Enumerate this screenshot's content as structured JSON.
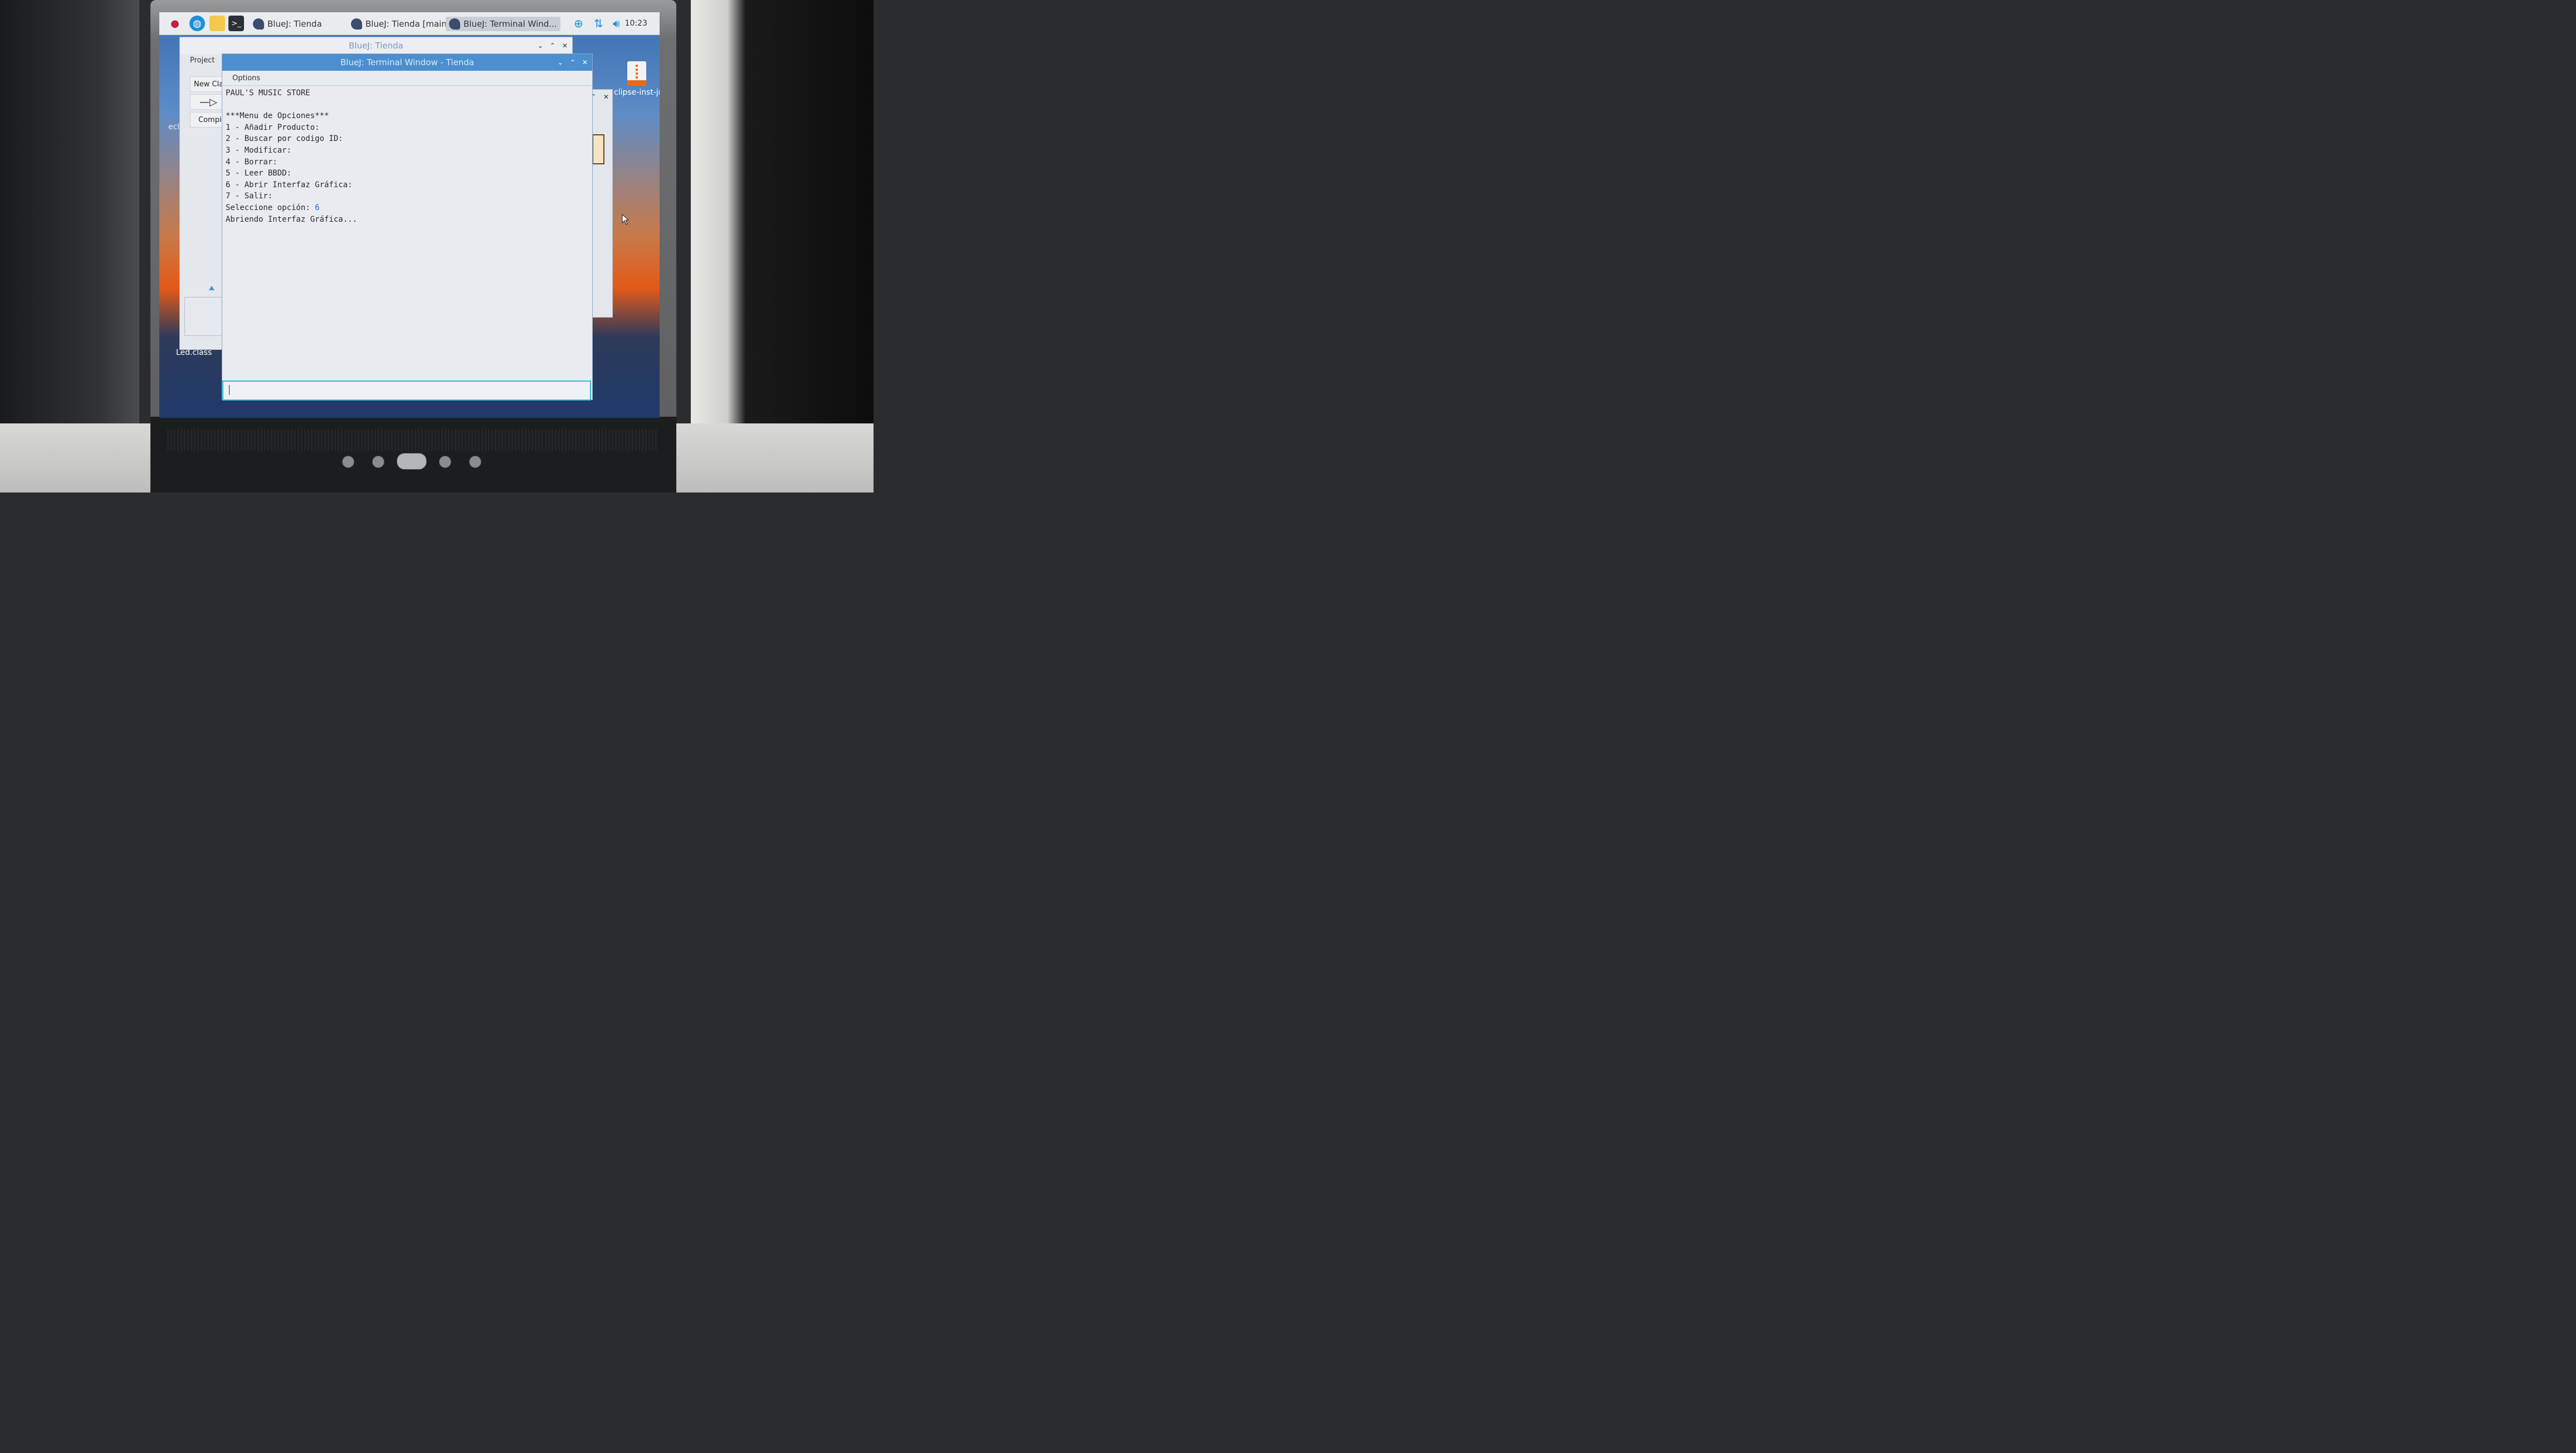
{
  "taskbar": {
    "tasks": [
      {
        "label": "BlueJ: Tienda"
      },
      {
        "label": "BlueJ: Tienda  [main]"
      },
      {
        "label": "BlueJ: Terminal Wind..."
      }
    ],
    "clock": "10:23",
    "icons": [
      "raspberry-menu-icon",
      "web-browser-icon",
      "file-manager-icon",
      "terminal-icon",
      "download-icon",
      "network-icon",
      "volume-icon"
    ]
  },
  "desktop": {
    "file_label": "clipse-inst-jr...",
    "ecl_label": "ecl",
    "led_label": "Led.class"
  },
  "main_window": {
    "title": "BlueJ: Tienda",
    "menu_project": "Project",
    "new_class": "New Class",
    "arrow": "—▷",
    "compile": "Compile"
  },
  "terminal": {
    "title": "BlueJ: Terminal Window - Tienda",
    "menu_options": "Options",
    "lines": [
      "PAUL'S MUSIC STORE",
      "",
      "***Menu de Opciones***",
      "1 - Añadir Producto:",
      "2 - Buscar por codigo ID:",
      "3 - Modificar:",
      "4 - Borrar:",
      "5 - Leer BBDD:",
      "6 - Abrir Interfaz Gráfica:",
      "7 - Salir:"
    ],
    "prompt": "Seleccione opción: ",
    "prompt_input": "6",
    "last_line": "Abriendo Interfaz Gráfica..."
  },
  "colors": {
    "accent": "#4b8fd0",
    "input_border": "#36b9d4",
    "typed_input": "#2a62c9"
  }
}
